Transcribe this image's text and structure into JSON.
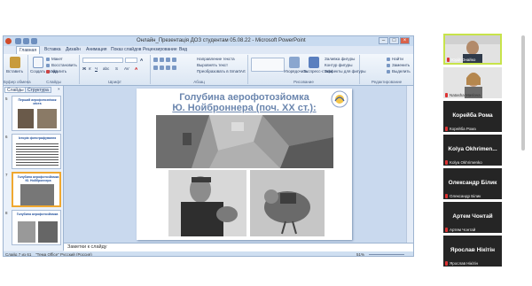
{
  "window": {
    "title": "Онлайн_Презентація ДОЗ студентам 05.08.22 - Microsoft PowerPoint",
    "tabs": [
      "Главная",
      "Вставка",
      "Дизайн",
      "Анимация",
      "Показ слайдов",
      "Рецензирование",
      "Вид"
    ],
    "active_tab": "Главная"
  },
  "ribbon": {
    "groups": [
      {
        "label": "Буфер обмена",
        "buttons": [
          "Вставить"
        ]
      },
      {
        "label": "Слайды",
        "buttons": [
          "Создать слайд",
          "Макет",
          "Восстановить",
          "Удалить"
        ]
      },
      {
        "label": "Шрифт",
        "buttons": []
      },
      {
        "label": "Абзац",
        "buttons": [
          "Направление текста",
          "Выровнять текст",
          "Преобразовать в SmartArt"
        ]
      },
      {
        "label": "Рисование",
        "buttons": [
          "Упорядочить",
          "Экспресс-стили",
          "Заливка фигуры",
          "Контур фигуры",
          "Эффекты для фигуры"
        ]
      },
      {
        "label": "Редактирование",
        "buttons": [
          "Найти",
          "Заменить",
          "Выделить"
        ]
      }
    ]
  },
  "pane": {
    "tabs": [
      "Слайды",
      "Структура"
    ],
    "thumbs": [
      {
        "num": "5",
        "title": "Перший аерофотознімок міста"
      },
      {
        "num": "6",
        "title": "Історія фотографування"
      },
      {
        "num": "7",
        "title": "Голубина аерофотозйомка Ю. Нойброннера"
      },
      {
        "num": "8",
        "title": "Голубина аерофотозйомка"
      }
    ]
  },
  "slide": {
    "title_line1": "Голубина аерофотозйомка",
    "title_line2": "Ю. Нойброннера (поч. ХХ ст.):"
  },
  "notes": {
    "placeholder": "Заметки к слайду"
  },
  "status": {
    "slide": "Слайд 7 из 61",
    "theme": "\"Тема Office\"",
    "language": "Русский (Россия)",
    "zoom": "51%"
  },
  "participants": [
    {
      "name": "",
      "label": "Юрій Онайко",
      "video": true,
      "active": true
    },
    {
      "name": "",
      "label": "Natasha Maslova",
      "video": true,
      "active": false
    },
    {
      "name": "Корейба Рома",
      "label": "Корейба Рома",
      "video": false
    },
    {
      "name": "Kolya  Okhrimen...",
      "label": "Kolya  Okhrimenko",
      "video": false
    },
    {
      "name": "Олександр Білик",
      "label": "Олександр Білик",
      "video": false
    },
    {
      "name": "Артем Чонтай",
      "label": "Артем Чонтай",
      "video": false
    },
    {
      "name": "Ярослав Нікітін",
      "label": "Ярослав Нікітін",
      "video": false
    }
  ],
  "colors": {
    "accent": "#f0a830",
    "ribbon": "#dbe6f3",
    "title_blue": "#6b86ae"
  }
}
